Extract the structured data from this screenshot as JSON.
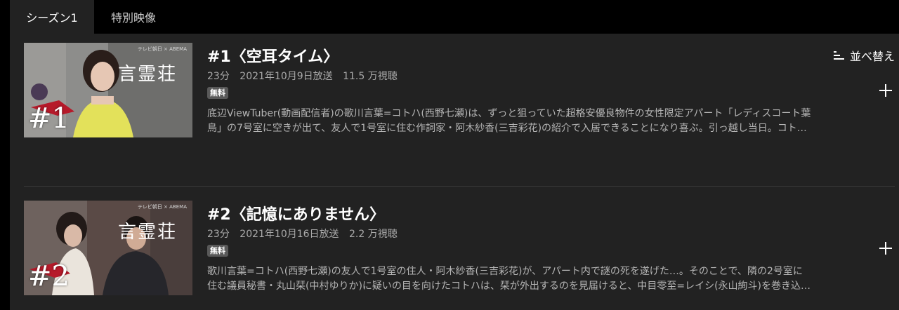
{
  "tabs": [
    {
      "label": "シーズン1",
      "active": true
    },
    {
      "label": "特別映像",
      "active": false
    }
  ],
  "sort": {
    "label": "並べ替え",
    "icon": "sort-icon"
  },
  "episodes": [
    {
      "title": "#1〈空耳タイム〉",
      "duration": "23分",
      "broadcast": "2021年10月9日放送",
      "views": "11.5 万視聴",
      "badge": "無料",
      "thumbnail": {
        "number": "#1",
        "logo": "言霊荘",
        "credit": "テレビ朝日 × ABEMA"
      },
      "description_lines": [
        "底辺ViewTuber(動画配信者)の歌川言葉=コトハ(西野七瀬)は、ずっと狙っていた超格安優良物件の女性限定アパート「レディスコート葉",
        "鳥」の7号室に空きが出て、友人で1号室に住む作詞家・阿木紗香(三吉彩花)の紹介で入居できることになり喜ぶ。引っ越し当日。コト…"
      ],
      "add_icon": "plus-icon"
    },
    {
      "title": "#2〈記憶にありません〉",
      "duration": "23分",
      "broadcast": "2021年10月16日放送",
      "views": "2.2 万視聴",
      "badge": "無料",
      "thumbnail": {
        "number": "#2",
        "logo": "言霊荘",
        "credit": "テレビ朝日 × ABEMA"
      },
      "description_lines": [
        "歌川言葉=コトハ(西野七瀬)の友人で1号室の住人・阿木紗香(三吉彩花)が、アパート内で謎の死を遂げた…。そのことで、隣の2号室に",
        "住む議員秘書・丸山栞(中村ゆりか)に疑いの目を向けたコトハは、栞が外出するのを見届けると、中目零至=レイシ(永山絢斗)を巻き込…"
      ],
      "add_icon": "plus-icon"
    }
  ],
  "colors": {
    "background": "#000000",
    "panel": "#222222",
    "badge": "#595959",
    "meta_text": "#a9a9a9",
    "desc_text": "#b5b5b5"
  }
}
